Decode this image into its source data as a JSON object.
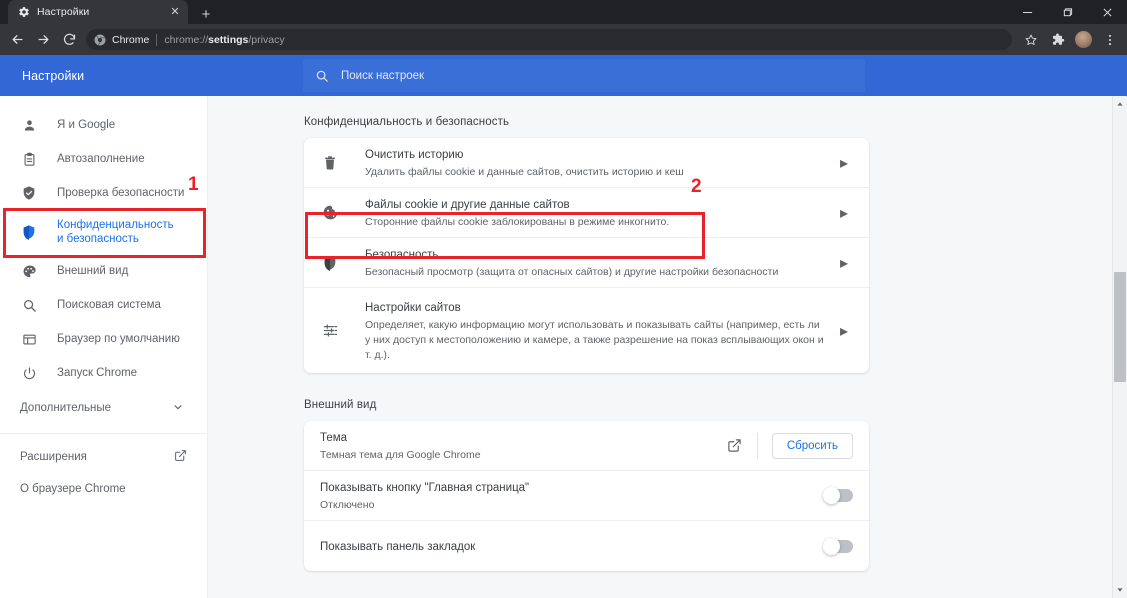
{
  "window": {
    "controls": {
      "minimize": "—",
      "maximize": "❐",
      "close": "✕"
    }
  },
  "tabstrip": {
    "tabs": [
      {
        "title": "Настройки",
        "favicon": "gear-icon",
        "close": "✕"
      }
    ],
    "new_tab_label": "+"
  },
  "toolbar": {
    "back": "←",
    "forward": "→",
    "reload": "↻",
    "omnibox": {
      "security_icon": "chrome-logo-icon",
      "chip_label": "Chrome",
      "url_prefix": "chrome://",
      "url_bold": "settings",
      "url_suffix": "/privacy"
    },
    "bookmark_star": "☆",
    "extensions_icon": "puzzle-icon",
    "profile_avatar": "avatar",
    "menu": "⋮"
  },
  "settings": {
    "title": "Настройки",
    "search": {
      "placeholder": "Поиск настроек",
      "value": "",
      "icon": "search-icon"
    }
  },
  "sidebar": {
    "items": [
      {
        "label": "Я и Google",
        "icon": "person-icon",
        "active": false
      },
      {
        "label": "Автозаполнение",
        "icon": "clipboard-icon",
        "active": false
      },
      {
        "label": "Проверка безопасности",
        "icon": "shield-check-icon",
        "active": false
      },
      {
        "label": "Конфиденциальность и безопасность",
        "icon": "shield-icon",
        "active": true
      },
      {
        "label": "Внешний вид",
        "icon": "palette-icon",
        "active": false
      },
      {
        "label": "Поисковая система",
        "icon": "search-icon",
        "active": false
      },
      {
        "label": "Браузер по умолчанию",
        "icon": "window-icon",
        "active": false
      },
      {
        "label": "Запуск Chrome",
        "icon": "power-icon",
        "active": false
      }
    ],
    "advanced": {
      "label": "Дополнительные",
      "chevron": "▾"
    },
    "footer": [
      {
        "label": "Расширения",
        "external_icon": "external-link-icon"
      },
      {
        "label": "О браузере Chrome",
        "external_icon": ""
      }
    ]
  },
  "main": {
    "privacy": {
      "section_title": "Конфиденциальность и безопасность",
      "rows": [
        {
          "icon": "trash-icon",
          "title": "Очистить историю",
          "subtitle": "Удалить файлы cookie и данные сайтов, очистить историю и кеш",
          "arrow": "▸"
        },
        {
          "icon": "cookie-icon",
          "title": "Файлы cookie и другие данные сайтов",
          "subtitle": "Сторонние файлы cookie заблокированы в режиме инкогнито.",
          "arrow": "▸"
        },
        {
          "icon": "shield-icon",
          "title": "Безопасность",
          "subtitle": "Безопасный просмотр (защита от опасных сайтов) и другие настройки безопасности",
          "arrow": "▸"
        },
        {
          "icon": "sliders-icon",
          "title": "Настройки сайтов",
          "subtitle": "Определяет, какую информацию могут использовать и показывать сайты (например, есть ли у них доступ к местоположению и камере, а также разрешение на показ всплывающих окон и т. д.).",
          "arrow": "▸"
        }
      ]
    },
    "appearance": {
      "section_title": "Внешний вид",
      "theme": {
        "title": "Тема",
        "subtitle": "Темная тема для Google Chrome",
        "external_icon": "external-link-icon",
        "reset_label": "Сбросить"
      },
      "home_button": {
        "title": "Показывать кнопку \"Главная страница\"",
        "subtitle": "Отключено",
        "state": "off"
      },
      "bookmarks_bar": {
        "title": "Показывать панель закладок",
        "subtitle": "",
        "state": "off"
      }
    }
  },
  "annotations": [
    {
      "number": "1"
    },
    {
      "number": "2"
    }
  ],
  "colors": {
    "accent_blue": "#1a73e8",
    "header_blue": "#3367d6",
    "annotation_red": "#e8232a",
    "chrome_dark": "#202124",
    "page_bg": "#f6f7f9"
  }
}
